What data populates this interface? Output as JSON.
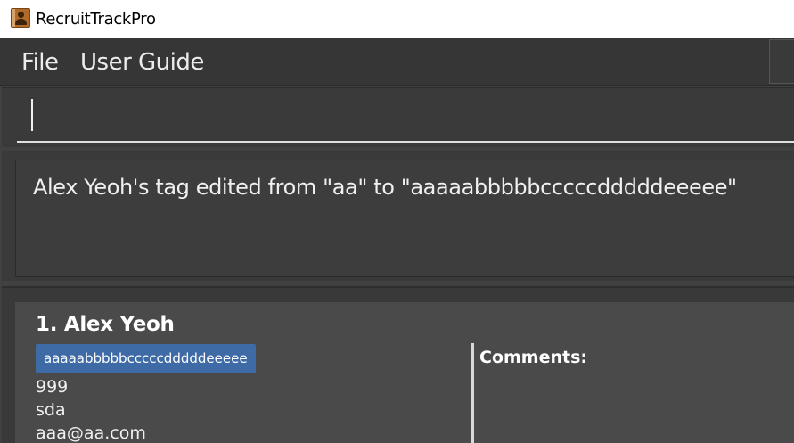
{
  "window": {
    "title": "RecruitTrackPro"
  },
  "menu": {
    "file_label": "File",
    "guide_label": "User Guide"
  },
  "command": {
    "value": ""
  },
  "result": {
    "message": "Alex Yeoh's tag edited from \"aa\" to \"aaaaabbbbbcccccdddddeeeee\""
  },
  "persons": [
    {
      "index_name": "1.  Alex Yeoh",
      "tag": "aaaaabbbbbcccccdddddeeeee",
      "phone": "999",
      "address": "sda",
      "email": "aaa@aa.com",
      "comments_label": "Comments:"
    }
  ],
  "colors": {
    "background": "#414141",
    "menubar": "#363636",
    "tag": "#3e6aa6",
    "card": "#4a4a4a"
  }
}
